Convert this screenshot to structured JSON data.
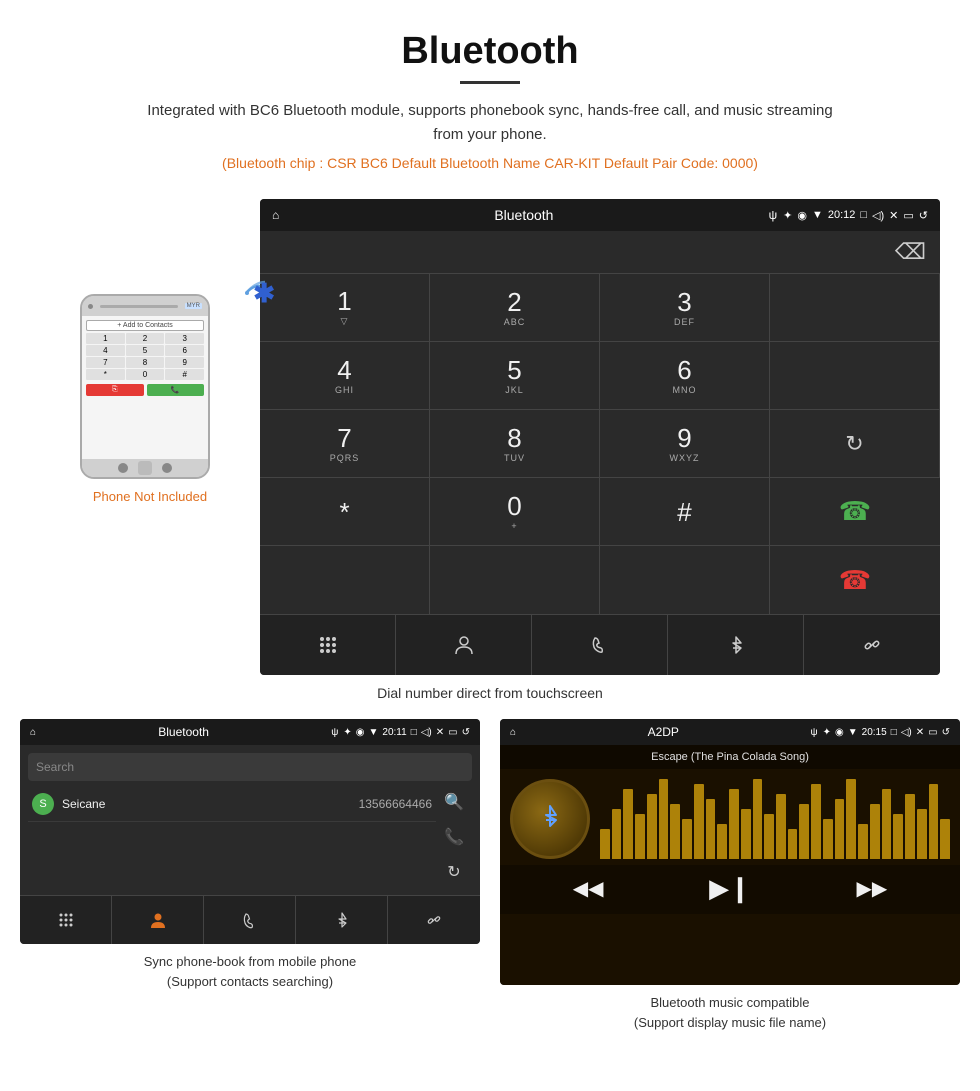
{
  "page": {
    "title": "Bluetooth",
    "description": "Integrated with BC6 Bluetooth module, supports phonebook sync, hands-free call, and music streaming from your phone.",
    "specs": "(Bluetooth chip : CSR BC6    Default Bluetooth Name CAR-KIT    Default Pair Code: 0000)",
    "dialer_caption": "Dial number direct from touchscreen",
    "phonebook_caption": "Sync phone-book from mobile phone\n(Support contacts searching)",
    "music_caption": "Bluetooth music compatible\n(Support display music file name)"
  },
  "phone_illustration": {
    "not_included": "Phone Not Included",
    "add_to_contacts": "+ Add to Contacts"
  },
  "dialer": {
    "title": "Bluetooth",
    "time": "20:12",
    "keys": [
      {
        "main": "1",
        "sub": ""
      },
      {
        "main": "2",
        "sub": "ABC"
      },
      {
        "main": "3",
        "sub": "DEF"
      },
      {
        "main": "",
        "sub": ""
      },
      {
        "main": "4",
        "sub": "GHI"
      },
      {
        "main": "5",
        "sub": "JKL"
      },
      {
        "main": "6",
        "sub": "MNO"
      },
      {
        "main": "",
        "sub": ""
      },
      {
        "main": "7",
        "sub": "PQRS"
      },
      {
        "main": "8",
        "sub": "TUV"
      },
      {
        "main": "9",
        "sub": "WXYZ"
      },
      {
        "main": "↻",
        "sub": ""
      },
      {
        "main": "*",
        "sub": ""
      },
      {
        "main": "0",
        "sub": "+"
      },
      {
        "main": "#",
        "sub": ""
      },
      {
        "main": "CALL",
        "sub": ""
      },
      {
        "main": "HANGUP",
        "sub": ""
      }
    ],
    "bottom_icons": [
      "⊞",
      "👤",
      "📞",
      "✦",
      "🔗"
    ]
  },
  "phonebook": {
    "title": "Bluetooth",
    "time": "20:11",
    "search_placeholder": "Search",
    "contacts": [
      {
        "letter": "S",
        "name": "Seicane",
        "number": "13566664466"
      }
    ],
    "right_icons": [
      "🔍",
      "📞",
      "↻"
    ]
  },
  "music": {
    "title": "A2DP",
    "time": "20:15",
    "song_title": "Escape (The Pina Colada Song)",
    "viz_heights": [
      30,
      50,
      70,
      45,
      65,
      80,
      55,
      40,
      75,
      60,
      35,
      70,
      50,
      80,
      45,
      65,
      30,
      55,
      75,
      40,
      60,
      80,
      35,
      55,
      70,
      45,
      65,
      50,
      75,
      40
    ]
  },
  "colors": {
    "accent_orange": "#e07020",
    "bluetooth_blue": "#3060d0",
    "screen_bg": "#2a2a2a",
    "status_bar_bg": "#1a1a1a",
    "call_green": "#4caf50",
    "hangup_red": "#e53935",
    "music_gold": "#c8960a"
  }
}
